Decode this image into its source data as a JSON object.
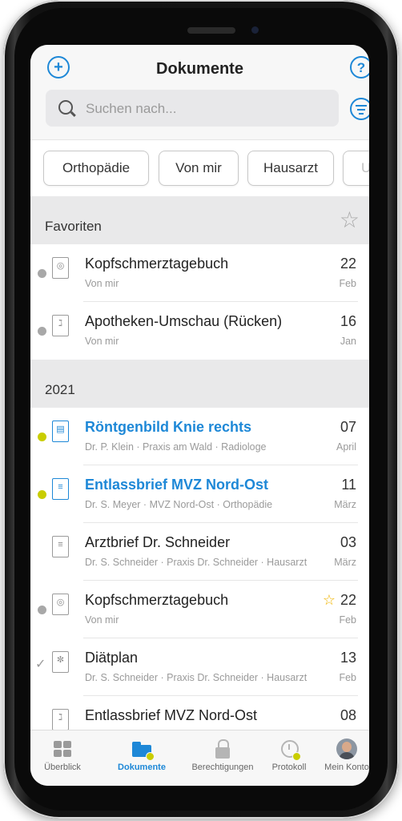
{
  "header": {
    "title": "Dokumente",
    "add_icon": "plus-circle-icon",
    "help_icon": "question-circle-icon",
    "filter_icon": "filter-icon"
  },
  "search": {
    "placeholder": "Suchen nach..."
  },
  "chips": [
    "Orthopädie",
    "Von mir",
    "Hausarzt",
    "Ur"
  ],
  "favorites_section": {
    "label": "Favoriten",
    "icon": "star-outline-icon"
  },
  "favorites": [
    {
      "title": "Kopfschmerztagebuch",
      "subtitle": "Von mir",
      "day": "22",
      "month": "Feb",
      "icon": "document-person-icon",
      "status": "grey-dot"
    },
    {
      "title": "Apotheken-Umschau (Rücken)",
      "subtitle": "Von mir",
      "day": "16",
      "month": "Jan",
      "icon": "document-pdf-icon",
      "status": "grey-dot"
    }
  ],
  "year_section": {
    "label": "2021"
  },
  "documents": [
    {
      "title": "Röntgenbild Knie rechts",
      "subtitle": "Dr. P. Klein · Praxis am Wald · Radiologe",
      "day": "07",
      "month": "April",
      "icon": "document-image-icon",
      "status": "green-dot",
      "unread": true
    },
    {
      "title": "Entlassbrief MVZ Nord-Ost",
      "subtitle": "Dr. S. Meyer · MVZ Nord-Ost · Orthopädie",
      "day": "11",
      "month": "März",
      "icon": "document-text-icon",
      "status": "green-dot",
      "unread": true
    },
    {
      "title": "Arztbrief Dr. Schneider",
      "subtitle": "Dr. S. Schneider · Praxis Dr. Schneider · Hausarzt",
      "day": "03",
      "month": "März",
      "icon": "document-text-icon",
      "status": "none",
      "unread": false
    },
    {
      "title": "Kopfschmerztagebuch",
      "subtitle": "Von mir",
      "day": "22",
      "month": "Feb",
      "icon": "document-person-icon",
      "status": "grey-dot",
      "unread": false,
      "favorite": true
    },
    {
      "title": "Diätplan",
      "subtitle": "Dr. S. Schneider · Praxis Dr. Schneider · Hausarzt",
      "day": "13",
      "month": "Feb",
      "icon": "document-wheat-icon",
      "status": "check",
      "unread": false
    },
    {
      "title": "Entlassbrief MVZ Nord-Ost",
      "subtitle": "",
      "day": "08",
      "month": "",
      "icon": "document-pdf-icon",
      "status": "none",
      "unread": false
    }
  ],
  "tabbar": [
    {
      "label": "Überblick",
      "icon": "grid-icon",
      "active": false
    },
    {
      "label": "Dokumente",
      "icon": "folder-icon",
      "active": true
    },
    {
      "label": "Berechtigungen",
      "icon": "unlock-icon",
      "active": false
    },
    {
      "label": "Protokoll",
      "icon": "history-icon",
      "active": false
    },
    {
      "label": "Mein Konto",
      "icon": "avatar-icon",
      "active": false
    }
  ],
  "colors": {
    "accent": "#1e88d7",
    "unread_dot": "#c9cd00",
    "favorite_star": "#f0b400"
  }
}
